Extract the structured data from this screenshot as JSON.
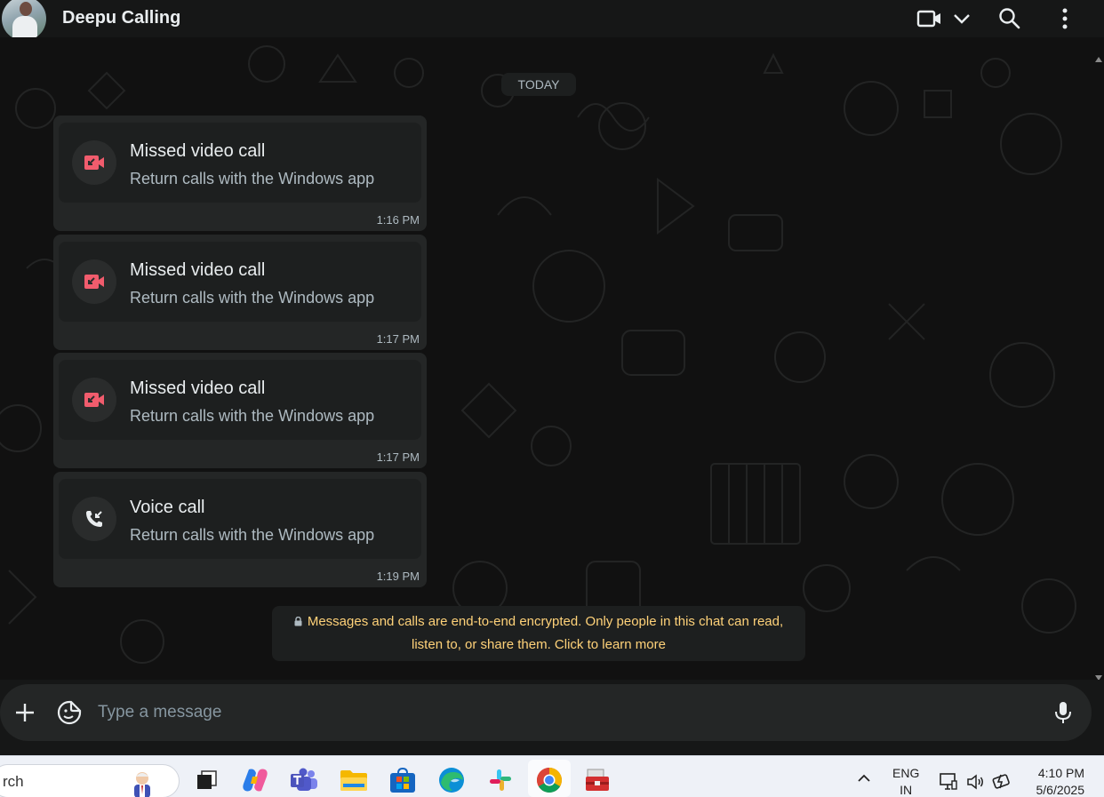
{
  "header": {
    "contact_name": "Deepu Calling"
  },
  "chat": {
    "date_label": "TODAY",
    "messages": [
      {
        "title": "Missed video call",
        "subtitle": "Return calls with the Windows app",
        "time": "1:16 PM",
        "icon": "missed-video-call-icon"
      },
      {
        "title": "Missed video call",
        "subtitle": "Return calls with the Windows app",
        "time": "1:17 PM",
        "icon": "missed-video-call-icon"
      },
      {
        "title": "Missed video call",
        "subtitle": "Return calls with the Windows app",
        "time": "1:17 PM",
        "icon": "missed-video-call-icon"
      },
      {
        "title": "Voice call",
        "subtitle": "Return calls with the Windows app",
        "time": "1:19 PM",
        "icon": "incoming-voice-call-icon"
      }
    ],
    "encryption_notice_line1": "Messages and calls are end-to-end encrypted. Only people in this chat can read,",
    "encryption_notice_line2": "listen to, or share them. Click to learn more"
  },
  "composer": {
    "placeholder": "Type a message"
  },
  "taskbar": {
    "search_text": "rch",
    "language_line1": "ENG",
    "language_line2": "IN",
    "time": "4:10 PM",
    "date": "5/6/2025"
  },
  "colors": {
    "missed_call": "#f15c6d",
    "notice_text": "#ffd279",
    "bubble": "#242626",
    "background": "#161717"
  }
}
